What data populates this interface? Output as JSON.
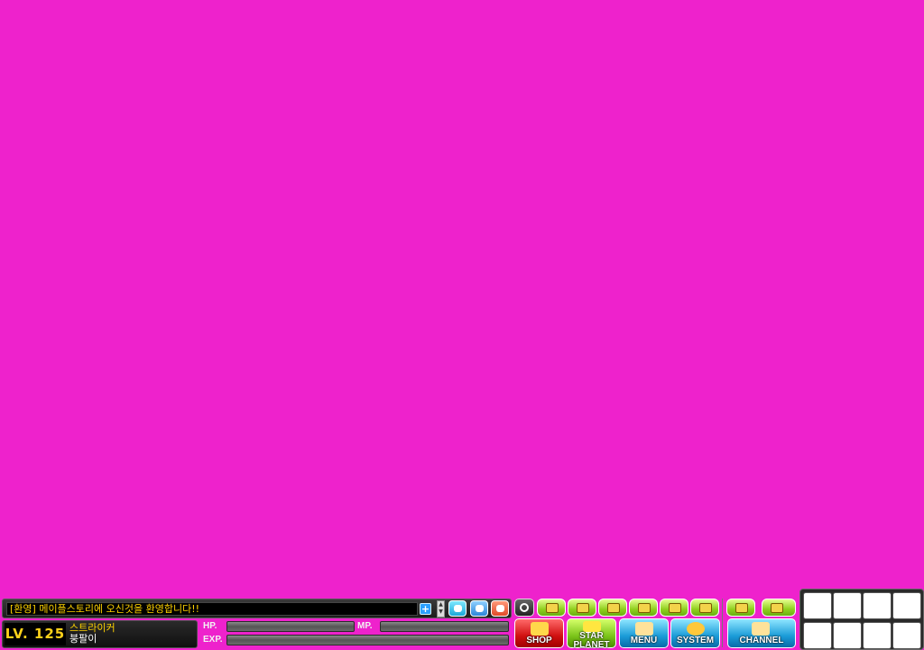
{
  "chat": {
    "message": "[환영] 메이플스토리에 오신것을 환영합니다!!",
    "expand_icon": "plus-icon",
    "scroll_up": "▲",
    "scroll_down": "▼"
  },
  "character": {
    "level": "LV. 125",
    "job": "스트라이커",
    "name": "붕팔이"
  },
  "gauges": {
    "hp_label": "HP.",
    "mp_label": "MP.",
    "exp_label": "EXP.",
    "hp_fraction": 0,
    "mp_fraction": 0,
    "exp_fraction": 0
  },
  "menu": {
    "shop": "SHOP",
    "star_planet_1": "STAR",
    "star_planet_2": "PLANET",
    "menu": "MENU",
    "system": "SYSTEM",
    "channel": "CHANNEL"
  },
  "colors": {
    "background": "#ee22cc",
    "chat_text": "#ffd200",
    "level_text": "#ffd21a"
  },
  "skill_slots": [
    "",
    "",
    "",
    "",
    "",
    "",
    "",
    ""
  ]
}
